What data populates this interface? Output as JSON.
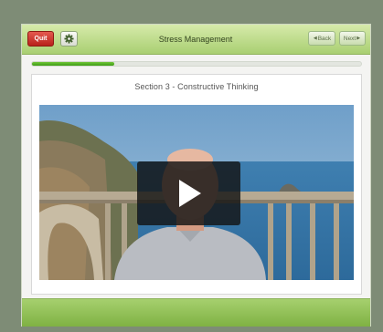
{
  "toolbar": {
    "quit_label": "Quit",
    "title": "Stress Management",
    "back_label": "Back",
    "next_label": "Next"
  },
  "progress": {
    "fraction": 0.25
  },
  "content": {
    "section_title": "Section 3 - Constructive Thinking"
  },
  "icons": {
    "settings": "gear-icon",
    "back": "triangle-left-icon",
    "next": "triangle-right-icon",
    "play": "play-icon"
  },
  "colors": {
    "toolbar_green": "#a9cf72",
    "quit_red": "#c9322a",
    "progress_green": "#4fae1f",
    "frame": "#7e8c76"
  }
}
